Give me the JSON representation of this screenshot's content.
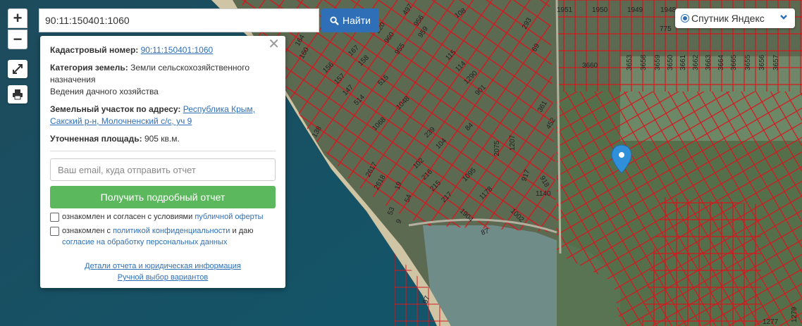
{
  "search": {
    "value": "90:11:150401:1060",
    "button_label": "Найти"
  },
  "zoom": {
    "in_label": "+",
    "out_label": "−"
  },
  "layer_selector": {
    "label": "Спутник Яндекс"
  },
  "popup": {
    "cadastral_label": "Кадастровый номер:",
    "cadastral_value": "90:11:150401:1060",
    "category_label": "Категория земель:",
    "category_value": "Земли сельскохозяйственного назначения",
    "usage_value": "Ведения дачного хозяйства",
    "address_label": "Земельный участок по адресу:",
    "address_value": "Республика Крым, Сакский р-н, Молочненский с/с, уч 9",
    "area_label": "Уточненная площадь:",
    "area_value": "905 кв.м.",
    "email_placeholder": "Ваш email, куда отправить отчет",
    "report_button": "Получить подробный отчет",
    "agree1_text": "ознакомлен и согласен с условиями",
    "agree1_link": "публичной оферты",
    "agree2_text": "ознакомлен с",
    "agree2_link": "политикой конфиденциальности",
    "agree2_text_b": "и даю",
    "agree2_link_b": "согласие на обработку персональных данных",
    "details_link": "Детали отчета и юридическая информация",
    "manual_link": "Ручной выбор вариантов"
  },
  "map_labels": [
    "1951",
    "1950",
    "1949",
    "1948",
    "775",
    "3660",
    "3653",
    "3658",
    "3659",
    "3650",
    "3661",
    "3662",
    "3663",
    "3664",
    "3665",
    "3655",
    "3656",
    "3657",
    "497",
    "956",
    "959",
    "960",
    "955",
    "220",
    "108",
    "293",
    "69",
    "164",
    "160",
    "167",
    "158",
    "156",
    "157",
    "147",
    "514",
    "515",
    "115",
    "114",
    "1290",
    "901",
    "1048",
    "1068",
    "361",
    "452",
    "138",
    "84",
    "239",
    "104",
    "2075",
    "1207",
    "102",
    "216",
    "215",
    "217",
    "1095",
    "1178",
    "917",
    "918",
    "1140",
    "1904",
    "1002",
    "87",
    "2617",
    "2618",
    "19",
    "54",
    "53",
    "9",
    "97",
    "1277",
    "1279"
  ],
  "colors": {
    "parcel_stroke": "#d8141c",
    "marker": "#2f8fd8",
    "button_blue": "#2e6fb7",
    "button_green": "#5cb85c"
  }
}
